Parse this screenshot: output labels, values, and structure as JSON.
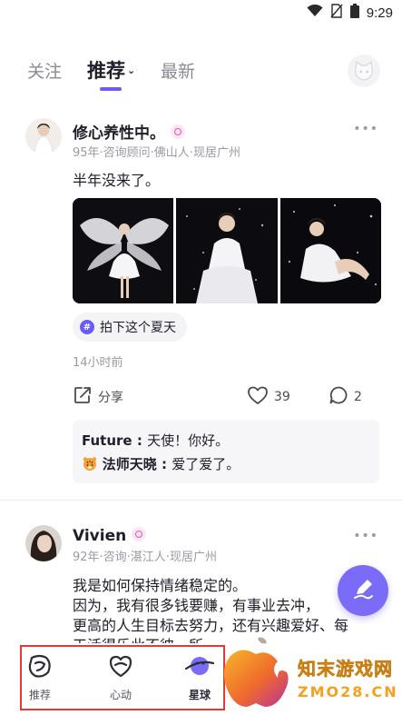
{
  "status_bar": {
    "time": "9:29",
    "icons": [
      "wifi-icon",
      "no-sim-icon",
      "battery-icon"
    ]
  },
  "top_tabs": [
    {
      "label": "关注",
      "active": false
    },
    {
      "label": "推荐",
      "active": true
    },
    {
      "label": "最新",
      "active": false
    }
  ],
  "posts": [
    {
      "name": "修心养性中。",
      "meta": "95年·咨询顾问·佛山人·现居广州",
      "text": "半年没来了。",
      "topic": "拍下这个夏天",
      "time": "14小时前",
      "share_label": "分享",
      "likes": "39",
      "comments_count": "2",
      "comments": [
        {
          "author": "Future",
          "sep": " : ",
          "text": "天使！你好。"
        },
        {
          "author": "法师天晓",
          "sep": " : ",
          "text": "爱了爱了。"
        }
      ]
    },
    {
      "name": "Vivien",
      "meta": "92年·咨询·湛江人·现居广州",
      "lines": [
        "我是如何保持情绪稳定的。",
        "因为，我有很多钱要赚，有事业去冲，",
        "更高的人生目标去努力，还有兴趣爱好、每",
        "天活得乐此不彼。所"
      ]
    }
  ],
  "bottom_nav": [
    {
      "label": "推荐",
      "icon": "recommend-icon"
    },
    {
      "label": "心动",
      "icon": "heart-icon"
    },
    {
      "label": "星球",
      "icon": "planet-icon",
      "active": true
    }
  ],
  "watermark": {
    "line1": "知末游戏网",
    "line2": "ZMO28.CN"
  },
  "colors": {
    "accent": "#6b5cf6",
    "fab": "#7a6cf7",
    "highlight": "#e53935"
  }
}
